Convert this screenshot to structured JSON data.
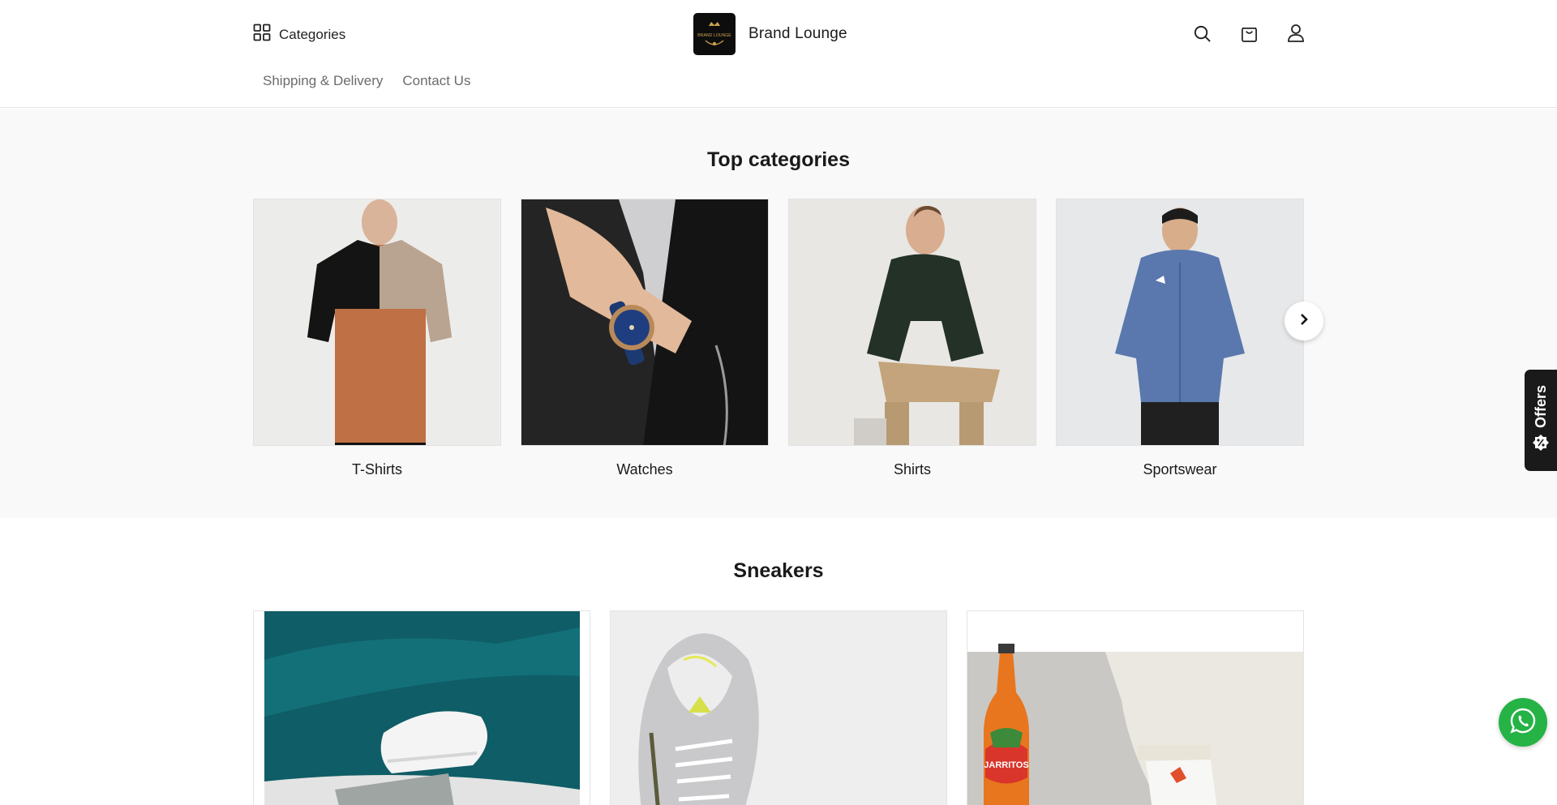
{
  "header": {
    "categories_label": "Categories",
    "brand_name": "Brand Lounge",
    "logo_text": "BRAND LOUNGE",
    "icons": [
      "search-icon",
      "bag-icon",
      "user-icon"
    ]
  },
  "nav": {
    "items": [
      {
        "label": "Shipping & Delivery"
      },
      {
        "label": "Contact Us"
      }
    ]
  },
  "top_categories": {
    "title": "Top categories",
    "items": [
      {
        "label": "T-Shirts"
      },
      {
        "label": "Watches"
      },
      {
        "label": "Shirts"
      },
      {
        "label": "Sportswear"
      }
    ]
  },
  "offers_tab": {
    "label": "Offers"
  },
  "sneakers": {
    "title": "Sneakers",
    "bottle_label": "JARRITOS"
  },
  "colors": {
    "accent": "#1a1a1a",
    "whatsapp": "#25b346",
    "section_bg": "#f9f9f9"
  }
}
